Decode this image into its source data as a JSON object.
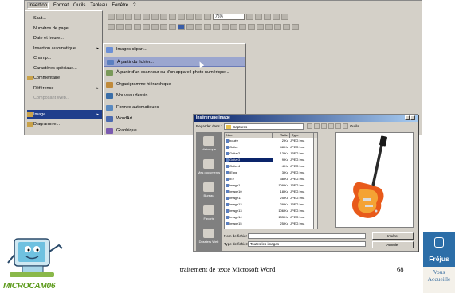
{
  "menubar": {
    "items": [
      "Insertion",
      "Format",
      "Outils",
      "Tableau",
      "Fenêtre",
      "?"
    ]
  },
  "zoom": "75%",
  "insert_menu": {
    "items": [
      {
        "label": "Saut...",
        "arrow": false,
        "disabled": false
      },
      {
        "label": "Numéros de page...",
        "arrow": false,
        "disabled": false
      },
      {
        "label": "Date et heure...",
        "arrow": false,
        "disabled": false
      },
      {
        "label": "Insertion automatique",
        "arrow": true,
        "disabled": false
      },
      {
        "label": "Champ...",
        "arrow": false,
        "disabled": false
      },
      {
        "label": "Caractères spéciaux...",
        "arrow": false,
        "disabled": false
      },
      {
        "label": "Commentaire",
        "arrow": false,
        "disabled": false
      },
      {
        "label": "Référence",
        "arrow": true,
        "disabled": false
      },
      {
        "label": "Composant Web...",
        "arrow": false,
        "disabled": true
      },
      {
        "label": "Image",
        "arrow": true,
        "disabled": false,
        "highlighted": true
      },
      {
        "label": "Diagramme...",
        "arrow": false,
        "disabled": false
      }
    ]
  },
  "image_submenu": {
    "items": [
      {
        "label": "Images clipart...",
        "color": "#6b8fd6"
      },
      {
        "label": "À partir du fichier...",
        "color": "#5a7fc0",
        "highlighted": true
      },
      {
        "label": "À partir d'un scanneur ou d'un appareil photo numérique...",
        "color": "#7a9a5a"
      },
      {
        "label": "Organigramme hiérarchique",
        "color": "#c08a3a"
      },
      {
        "label": "Nouveau dessin",
        "color": "#3a6ea8"
      },
      {
        "label": "Formes automatiques",
        "color": "#5a8ac0"
      },
      {
        "label": "WordArt...",
        "color": "#4a6ab0"
      },
      {
        "label": "Graphique",
        "color": "#7a5ab0"
      }
    ]
  },
  "dialog": {
    "title": "Insérer une image",
    "look_in_label": "Regarder dans :",
    "look_in_value": "Captures",
    "views_label": "Outils",
    "places": [
      "Historique",
      "Mes documents",
      "Bureau",
      "Favoris",
      "Dossiers Web"
    ],
    "columns": [
      "Nom",
      "Taille",
      "Type"
    ],
    "files": [
      {
        "name": "bouée",
        "size": "2 Ko",
        "type": "JPEG Ima"
      },
      {
        "name": "Guitar",
        "size": "48 Ko",
        "type": "JPEG Ima"
      },
      {
        "name": "Guitar2",
        "size": "13 Ko",
        "type": "JPEG Ima"
      },
      {
        "name": "Guitar3",
        "size": "9 Ko",
        "type": "JPEG Ima",
        "selected": true
      },
      {
        "name": "Guitar4",
        "size": "4 Ko",
        "type": "JPEG Ima"
      },
      {
        "name": "IEtpg",
        "size": "3 Ko",
        "type": "JPEG Ima"
      },
      {
        "name": "IE2",
        "size": "38 Ko",
        "type": "JPEG Ima"
      },
      {
        "name": "Image1",
        "size": "109 Ko",
        "type": "JPEG Ima"
      },
      {
        "name": "Image10",
        "size": "18 Ko",
        "type": "JPEG Ima"
      },
      {
        "name": "Image11",
        "size": "25 Ko",
        "type": "JPEG Ima"
      },
      {
        "name": "Image12",
        "size": "29 Ko",
        "type": "JPEG Ima"
      },
      {
        "name": "Image13",
        "size": "106 Ko",
        "type": "JPEG Ima"
      },
      {
        "name": "Image14",
        "size": "133 Ko",
        "type": "JPEG Ima"
      },
      {
        "name": "Image15",
        "size": "25 Ko",
        "type": "JPEG Ima"
      }
    ],
    "filename_label": "Nom de fichier :",
    "filename_value": "",
    "filetype_label": "Type de fichiers :",
    "filetype_value": "Toutes les images",
    "insert_button": "Insérer",
    "cancel_button": "Annuler"
  },
  "footer": {
    "caption": "traitement de texte Microsoft Word",
    "page_number": "68",
    "logo_text": "MICROCAM06",
    "badge_city": "Fréjus",
    "badge_line1": "Vous",
    "badge_line2": "Accueille"
  }
}
